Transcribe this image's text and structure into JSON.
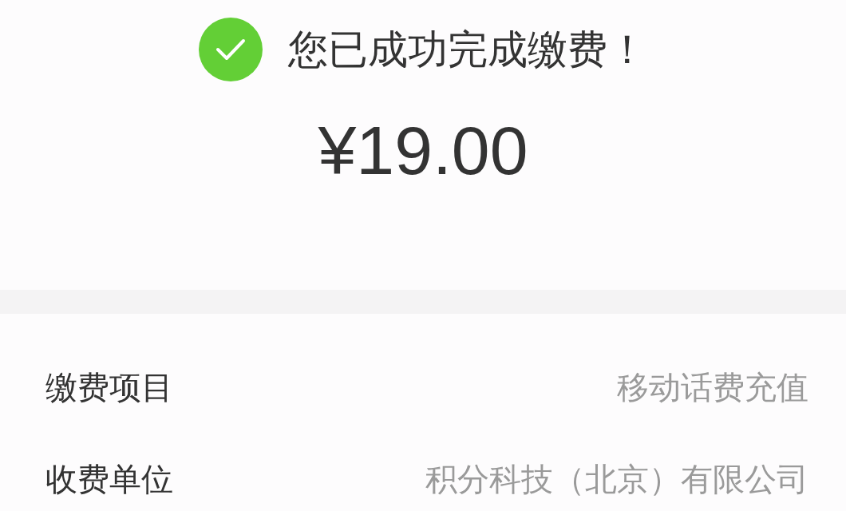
{
  "result": {
    "message": "您已成功完成缴费！",
    "amount": "¥19.00"
  },
  "details": [
    {
      "label": "缴费项目",
      "value": "移动话费充值"
    },
    {
      "label": "收费单位",
      "value": "积分科技（北京）有限公司"
    }
  ]
}
